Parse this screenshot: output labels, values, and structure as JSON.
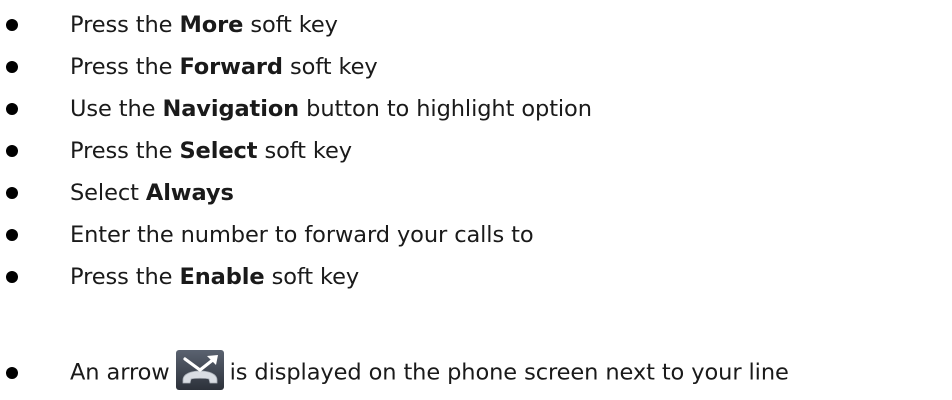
{
  "steps": [
    {
      "pre": "Press the ",
      "bold": "More",
      "post": " soft key"
    },
    {
      "pre": "Press the ",
      "bold": "Forward",
      "post": " soft key"
    },
    {
      "pre": "Use the ",
      "bold": "Navigation",
      "post": " button to highlight option"
    },
    {
      "pre": "Press the ",
      "bold": "Select",
      "post": " soft key"
    },
    {
      "pre": "Select ",
      "bold": "Always",
      "post": ""
    },
    {
      "pre": "Enter the number to forward your calls to",
      "bold": "",
      "post": ""
    },
    {
      "pre": "Press the ",
      "bold": "Enable",
      "post": " soft key"
    }
  ],
  "final_step": {
    "pre": "An arrow",
    "icon": "call-forward-arrow-icon",
    "post": "is displayed on the phone screen next to your line"
  }
}
